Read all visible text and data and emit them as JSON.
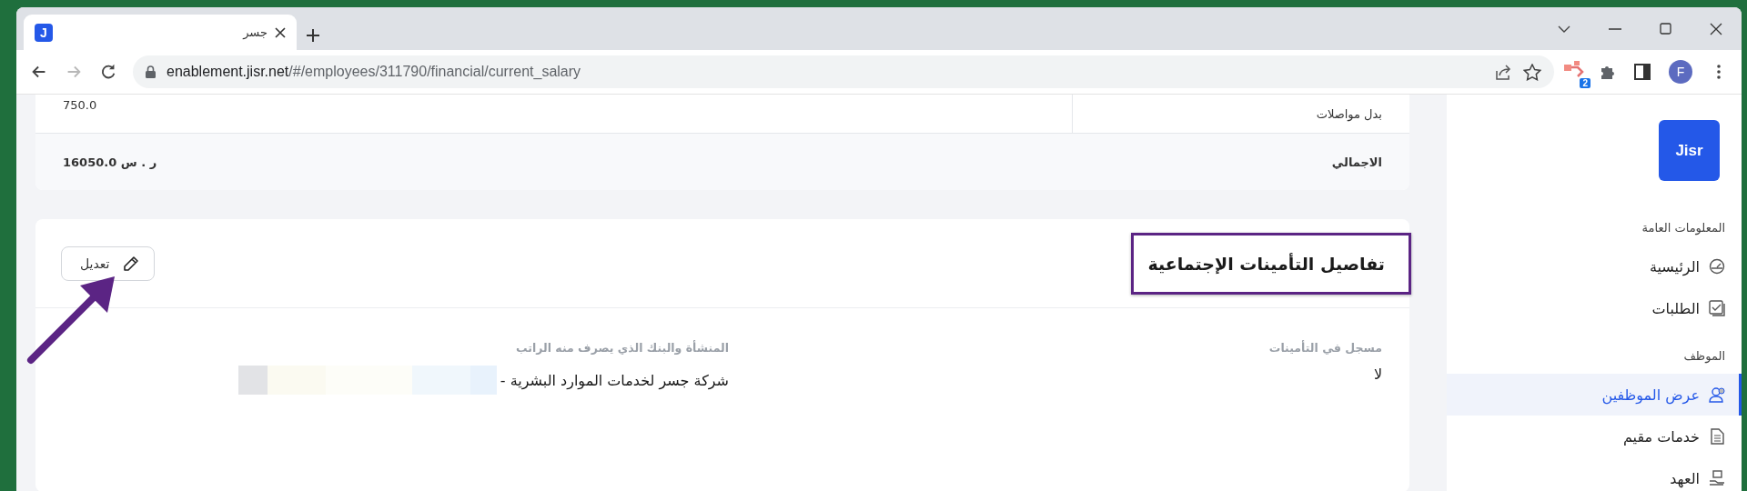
{
  "browser": {
    "tab": {
      "title": "جسر",
      "favicon": "J",
      "selected": true
    },
    "forward_disabled": true,
    "url": {
      "host": "enablement.jisr.net",
      "path": "/#/employees/311790/financial/current_salary"
    },
    "extension_badge": "2",
    "profile_initial": "F"
  },
  "salary": {
    "rows": [
      {
        "kind": "item",
        "label": "بدل مواصلات",
        "value": "750.0"
      },
      {
        "kind": "total",
        "label": "الاجمالي",
        "value": "16050.0 ر . س"
      }
    ]
  },
  "insurance": {
    "title": "تفاصيل التأمينات الإجتماعية",
    "edit_button": "تعديل",
    "fields": [
      {
        "label": "مسجل في التأمينات",
        "value": "لا",
        "redacted": false
      },
      {
        "label": "المنشأة والبنك الذي يصرف منه الراتب",
        "value": "شركة جسر لخدمات الموارد البشرية -",
        "redacted": true
      }
    ]
  },
  "sidebar": {
    "logo": "Jisr",
    "sections": [
      {
        "title": "المعلومات العامة",
        "items": [
          {
            "label": "الرئيسية",
            "selected": false
          },
          {
            "label": "الطلبات",
            "selected": false
          }
        ]
      },
      {
        "title": "الموظف",
        "items": [
          {
            "label": "عرض الموظفين",
            "selected": true
          },
          {
            "label": "خدمات مقيم",
            "selected": false
          },
          {
            "label": "العهد",
            "selected": false
          }
        ]
      }
    ]
  }
}
